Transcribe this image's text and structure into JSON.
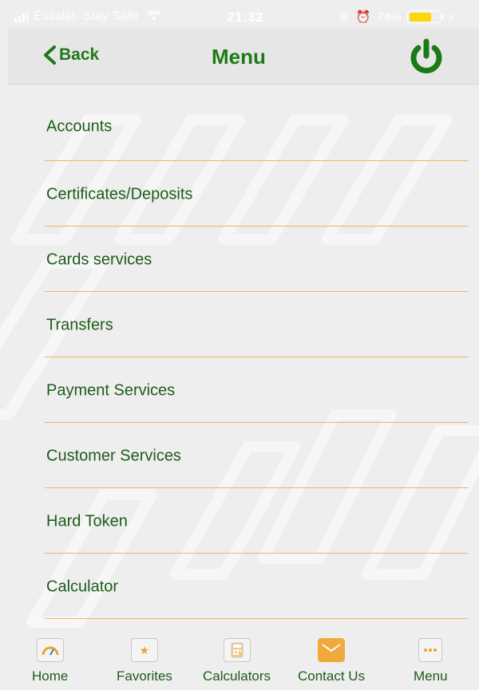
{
  "status_bar": {
    "carrier": "Etisalat- Stay Safe",
    "time": "21:32",
    "battery": "74%",
    "battery_level": 0.74
  },
  "header": {
    "back_label": "Back",
    "title": "Menu"
  },
  "menu": {
    "items": [
      {
        "label": "Accounts"
      },
      {
        "label": "Certificates/Deposits"
      },
      {
        "label": "Cards services"
      },
      {
        "label": "Transfers"
      },
      {
        "label": "Payment Services"
      },
      {
        "label": "Customer Services"
      },
      {
        "label": "Hard Token"
      },
      {
        "label": "Calculator"
      }
    ]
  },
  "tabbar": {
    "tabs": [
      {
        "label": "Home",
        "icon": "speedometer-icon"
      },
      {
        "label": "Favorites",
        "icon": "star-icon"
      },
      {
        "label": "Calculators",
        "icon": "calculator-icon"
      },
      {
        "label": "Contact Us",
        "icon": "envelope-icon"
      },
      {
        "label": "Menu",
        "icon": "more-dots-icon"
      }
    ]
  },
  "colors": {
    "brand_green": "#1e7a18",
    "divider_orange": "#f2b45a",
    "background": "#efefef"
  }
}
